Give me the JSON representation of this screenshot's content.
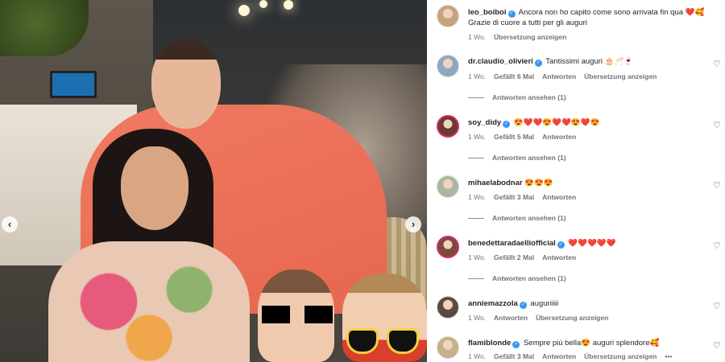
{
  "post": {
    "carousel": {
      "prev_icon": "chevron-left-icon",
      "next_icon": "chevron-right-icon"
    }
  },
  "comments": [
    {
      "username": "leo_boiboi",
      "verified": true,
      "text": "Ancora non ho capito come sono arrivata fin qua ❤️🥰 Grazie di cuore a tutti per gli auguri",
      "time": "1 Wo.",
      "likes": "",
      "reply": "",
      "translate": "Übersetzung anzeigen",
      "view_replies": "",
      "avatar_color": "#c9a27e"
    },
    {
      "username": "dr.claudio_olivieri",
      "verified": true,
      "text": "Tantissimi auguri 🎂🥂🍷",
      "time": "1 Wo.",
      "likes": "Gefällt 6 Mal",
      "reply": "Antworten",
      "translate": "Übersetzung anzeigen",
      "view_replies": "Antworten ansehen (1)",
      "avatar_color": "#8ea7c2"
    },
    {
      "username": "soy_didy",
      "verified": true,
      "text": "😍❤️❤️😍❤️❤️😍❤️😍",
      "time": "1 Wo.",
      "likes": "Gefällt 5 Mal",
      "reply": "Antworten",
      "translate": "",
      "view_replies": "Antworten ansehen (1)",
      "avatar_color": "#6b3a2e"
    },
    {
      "username": "mihaelabodnar",
      "verified": false,
      "text": "😍😍😍",
      "time": "1 Wo.",
      "likes": "Gefällt 3 Mal",
      "reply": "Antworten",
      "translate": "",
      "view_replies": "Antworten ansehen (1)",
      "avatar_color": "#a8b8a0"
    },
    {
      "username": "benedettaradaelliofficial",
      "verified": true,
      "text": "❤️❤️❤️❤️❤️",
      "time": "1 Wo.",
      "likes": "Gefällt 2 Mal",
      "reply": "Antworten",
      "translate": "",
      "view_replies": "Antworten ansehen (1)",
      "avatar_color": "#7a4a3a"
    },
    {
      "username": "anniemazzola",
      "verified": true,
      "text": "auguriiiii",
      "time": "1 Wo.",
      "likes": "",
      "reply": "Antworten",
      "translate": "Übersetzung anzeigen",
      "view_replies": "",
      "avatar_color": "#5a4a42"
    },
    {
      "username": "flamiblonde",
      "verified": true,
      "text": "Sempre più bella😍 auguri splendore🥰",
      "time": "1 Wo.",
      "likes": "Gefällt 3 Mal",
      "reply": "Antworten",
      "translate": "Übersetzung anzeigen",
      "more": "•••",
      "view_replies": "",
      "avatar_color": "#c7b08a"
    }
  ],
  "icons": {
    "like": "heart-outline-icon",
    "verified": "verified-badge-icon",
    "more": "more-options-icon"
  }
}
